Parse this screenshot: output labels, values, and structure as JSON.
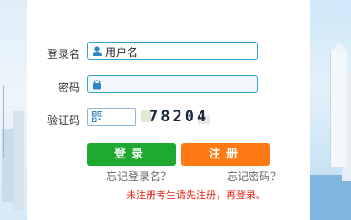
{
  "form": {
    "username_label": "登录名",
    "username_value": "用户名",
    "password_label": "密码",
    "password_value": "",
    "captcha_label": "验证码",
    "captcha_value": "",
    "captcha_image_text": "78204"
  },
  "buttons": {
    "login": "登录",
    "register": "注册"
  },
  "links": {
    "forgot_username": "忘记登录名？",
    "forgot_password": "忘记密码？"
  },
  "notice": "未注册考生请先注册，再登录。",
  "colors": {
    "login_button": "#1fa830",
    "register_button": "#ff7a14",
    "notice_text": "#e3241a",
    "field_border": "#3aa3d6"
  }
}
